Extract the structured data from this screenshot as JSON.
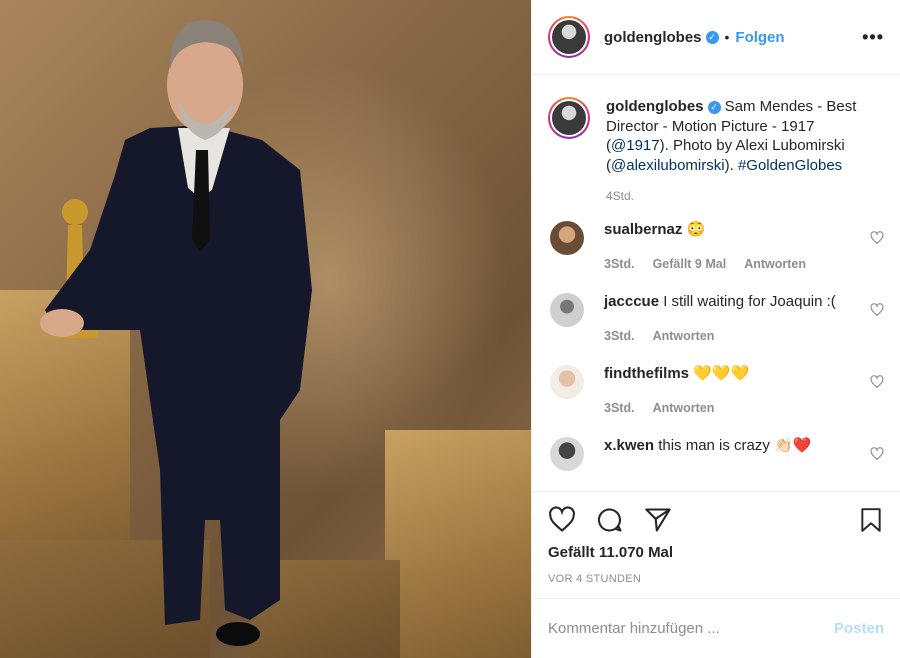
{
  "header": {
    "username": "goldenglobes",
    "verified_icon": "verified-badge-icon",
    "separator": "•",
    "follow_label": "Folgen",
    "more_label": "•••"
  },
  "caption": {
    "username": "goldenglobes",
    "text_plain": "Sam Mendes - Best Director - Motion Picture - 1917 (",
    "mention1": "@1917",
    "text_mid": "). Photo by Alexi Lubomirski (",
    "mention2": "@alexilubomirski",
    "text_end": "). ",
    "hashtag": "#GoldenGlobes",
    "time": "4Std."
  },
  "comments": [
    {
      "username": "sualbernaz",
      "text": "😳",
      "time": "3Std.",
      "likes": "Gefällt 9 Mal",
      "reply": "Antworten"
    },
    {
      "username": "jacccue",
      "text": "I still waiting for Joaquin :(",
      "time": "3Std.",
      "likes": "",
      "reply": "Antworten"
    },
    {
      "username": "findthefilms",
      "text": "💛💛💛",
      "time": "3Std.",
      "likes": "",
      "reply": "Antworten"
    },
    {
      "username": "x.kwen",
      "text": "this man is crazy 👏🏻❤️",
      "time": "",
      "likes": "",
      "reply": ""
    }
  ],
  "actions": {
    "likes_text": "Gefällt 11.070 Mal",
    "posted_ago": "VOR 4 STUNDEN"
  },
  "add_comment": {
    "placeholder": "Kommentar hinzufügen ...",
    "post_label": "Posten"
  },
  "colors": {
    "accent": "#3897f0",
    "link": "#003569",
    "muted": "#8e8e8e",
    "post_disabled": "#b2dffc"
  }
}
